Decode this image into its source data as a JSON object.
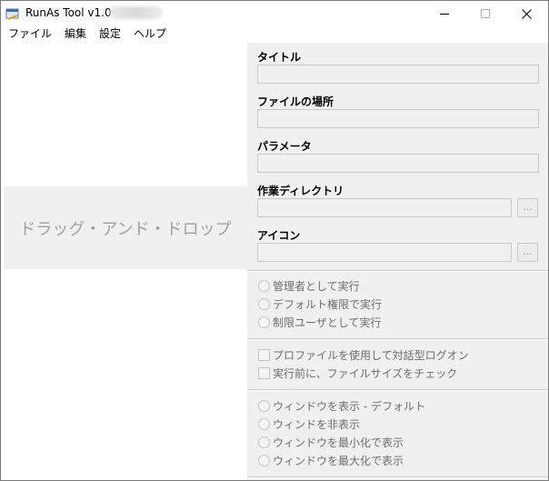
{
  "window": {
    "title": "RunAs Tool v1.0 -"
  },
  "menu": {
    "items": [
      "ファイル",
      "編集",
      "設定",
      "ヘルプ"
    ]
  },
  "drop_zone": {
    "text": "ドラッグ・アンド・ドロップ"
  },
  "form": {
    "title_label": "タイトル",
    "title_value": "",
    "location_label": "ファイルの場所",
    "location_value": "",
    "params_label": "パラメータ",
    "params_value": "",
    "workdir_label": "作業ディレクトリ",
    "workdir_value": "",
    "workdir_browse": "...",
    "icon_label": "アイコン",
    "icon_value": "",
    "icon_browse": "..."
  },
  "run_mode": {
    "options": [
      "管理者として実行",
      "デフォルト権限で実行",
      "制限ユーザとして実行"
    ]
  },
  "checks": {
    "options": [
      "プロファイルを使用して対話型ログオン",
      "実行前に、ファイルサイズをチェック"
    ]
  },
  "window_mode": {
    "options": [
      "ウィンドウを表示 - デフォルト",
      "ウィンドを非表示",
      "ウィンドウを最小化で表示",
      "ウィンドウを最大化で表示"
    ]
  },
  "icons": {
    "app": "runas-app-icon",
    "minimize": "minimize-icon",
    "maximize": "maximize-icon",
    "close": "close-icon"
  }
}
